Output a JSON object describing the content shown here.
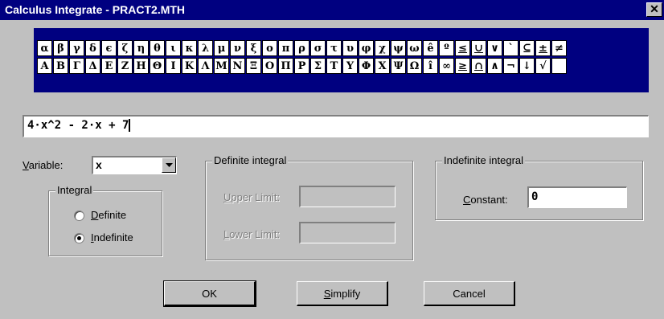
{
  "window": {
    "title": "Calculus Integrate - PRACT2.MTH",
    "close_glyph": "✕"
  },
  "symbols": {
    "row1": [
      "α",
      "β",
      "γ",
      "δ",
      "ϵ",
      "ζ",
      "η",
      "θ",
      "ι",
      "κ",
      "λ",
      "μ",
      "ν",
      "ξ",
      "ο",
      "π",
      "ρ",
      "σ",
      "τ",
      "υ",
      "φ",
      "χ",
      "ψ",
      "ω",
      "ê",
      "º",
      "≤",
      "∪",
      "∨",
      "`",
      "⊆",
      "±",
      "≠"
    ],
    "row2": [
      "Α",
      "Β",
      "Γ",
      "Δ",
      "Ε",
      "Ζ",
      "Η",
      "Θ",
      "Ι",
      "Κ",
      "Λ",
      "Μ",
      "Ν",
      "Ξ",
      "Ο",
      "Π",
      "Ρ",
      "Σ",
      "Τ",
      "Υ",
      "Φ",
      "Χ",
      "Ψ",
      "Ω",
      "î",
      "∞",
      "≥",
      "∩",
      "∧",
      "¬",
      "↓",
      "√",
      ""
    ]
  },
  "expression": {
    "value": "4·x^2 - 2·x + 7"
  },
  "variable": {
    "label_prefix": "V",
    "label_rest": "ariable:",
    "value": "x"
  },
  "integral_group": {
    "legend": "Integral",
    "options": [
      {
        "accel": "D",
        "rest": "efinite",
        "selected": false
      },
      {
        "accel": "I",
        "rest": "ndefinite",
        "selected": true
      }
    ]
  },
  "definite_group": {
    "legend": "Definite integral",
    "upper_accel": "U",
    "upper_rest": "pper Limit:",
    "upper_value": "",
    "lower_accel": "L",
    "lower_rest": "ower Limit:",
    "lower_value": ""
  },
  "indefinite_group": {
    "legend": "Indefinite integral",
    "constant_accel": "C",
    "constant_rest": "onstant:",
    "constant_value": "0"
  },
  "buttons": {
    "ok": "OK",
    "simplify_accel": "S",
    "simplify_rest": "implify",
    "cancel": "Cancel"
  }
}
